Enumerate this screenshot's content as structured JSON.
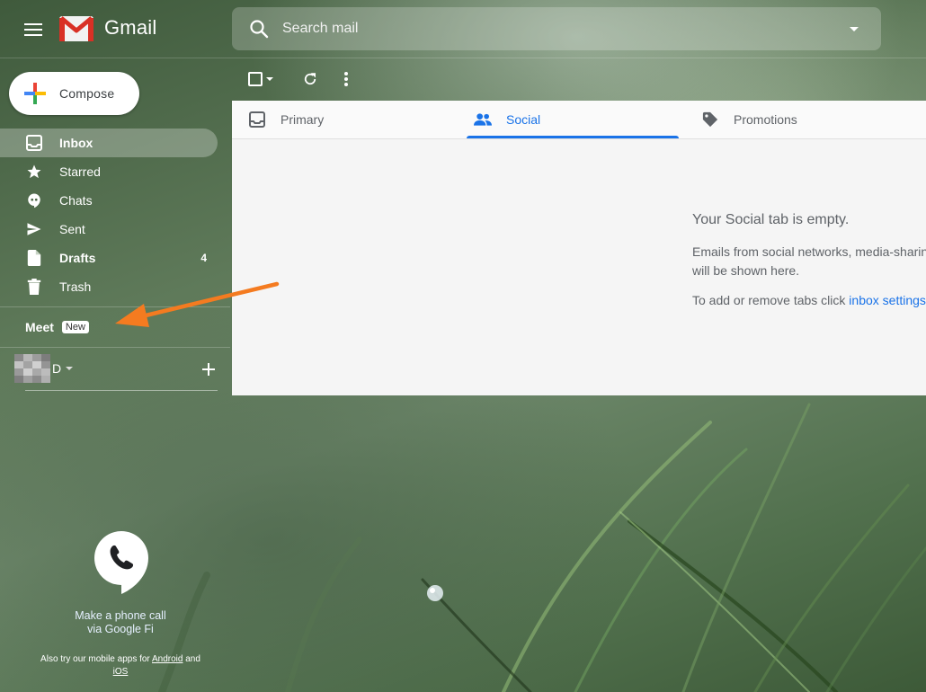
{
  "app": {
    "name": "Gmail"
  },
  "search": {
    "placeholder": "Search mail"
  },
  "compose": {
    "label": "Compose"
  },
  "nav": {
    "items": [
      {
        "label": "Inbox",
        "count": ""
      },
      {
        "label": "Starred",
        "count": ""
      },
      {
        "label": "Chats",
        "count": ""
      },
      {
        "label": "Sent",
        "count": ""
      },
      {
        "label": "Drafts",
        "count": "4"
      },
      {
        "label": "Trash",
        "count": ""
      }
    ]
  },
  "meet": {
    "label": "Meet",
    "badge": "New"
  },
  "hangouts": {
    "user": "D"
  },
  "phone": {
    "line1": "Make a phone call",
    "line2": "via Google Fi"
  },
  "mobile": {
    "prefix": "Also try our mobile apps for",
    "android": "Android",
    "and": "and",
    "ios": "iOS"
  },
  "tabs": [
    {
      "label": "Primary"
    },
    {
      "label": "Social"
    },
    {
      "label": "Promotions"
    }
  ],
  "empty": {
    "title": "Your Social tab is empty.",
    "desc_line1": "Emails from social networks, media-sharing",
    "desc_line2": "will be shown here.",
    "tabs_prefix": "To add or remove tabs click",
    "tabs_link": "inbox settings"
  },
  "colors": {
    "accent": "#1a73e8",
    "annotation_arrow": "#f47b20"
  }
}
